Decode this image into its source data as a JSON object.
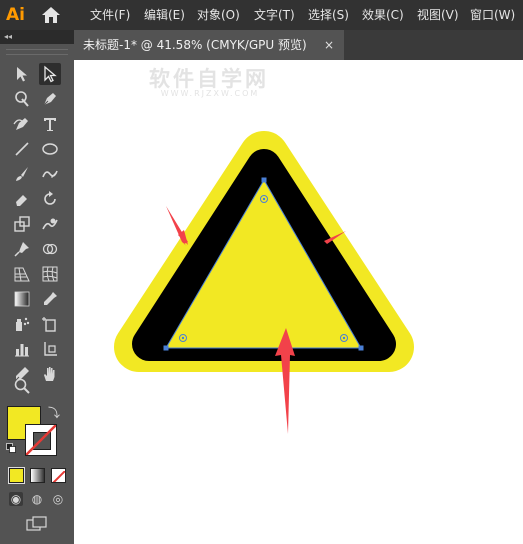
{
  "app": {
    "logo_text": "Ai",
    "accent_color": "#ff9a00"
  },
  "menu": {
    "items": [
      "文件(F)",
      "编辑(E)",
      "对象(O)",
      "文字(T)",
      "选择(S)",
      "效果(C)",
      "视图(V)",
      "窗口(W)"
    ]
  },
  "panel": {
    "collapse_label": "◂◂"
  },
  "document_tab": {
    "label": "未标题-1* @ 41.58% (CMYK/GPU 预览)",
    "close": "×"
  },
  "toolbar": {
    "tools": [
      "selection-tool",
      "direct-selection-tool",
      "magic-wand-tool",
      "pen-tool",
      "curvature-tool",
      "type-tool",
      "line-segment-tool",
      "ellipse-tool",
      "paintbrush-tool",
      "shaper-tool",
      "eraser-tool",
      "rotate-tool",
      "scale-tool",
      "warp-tool",
      "puppet-warp-tool",
      "shape-builder-tool",
      "perspective-grid-tool",
      "mesh-tool",
      "gradient-tool",
      "eyedropper-tool",
      "symbol-sprayer-tool",
      "artboard-tool",
      "column-graph-tool",
      "slice-tool",
      "hand-tool-alt",
      "hand-tool",
      "zoom-tool"
    ],
    "fill_color": "#f2e823",
    "stroke_color": "none"
  },
  "canvas": {
    "watermark": "软件自学网",
    "watermark_sub": "WWW.RJZXW.COM"
  },
  "artwork": {
    "outer_color": "#f2e823",
    "band_color": "#000000",
    "inner_color": "#f2e823",
    "path_color": "#4a7fd6",
    "arrow_color": "#f2424a"
  }
}
